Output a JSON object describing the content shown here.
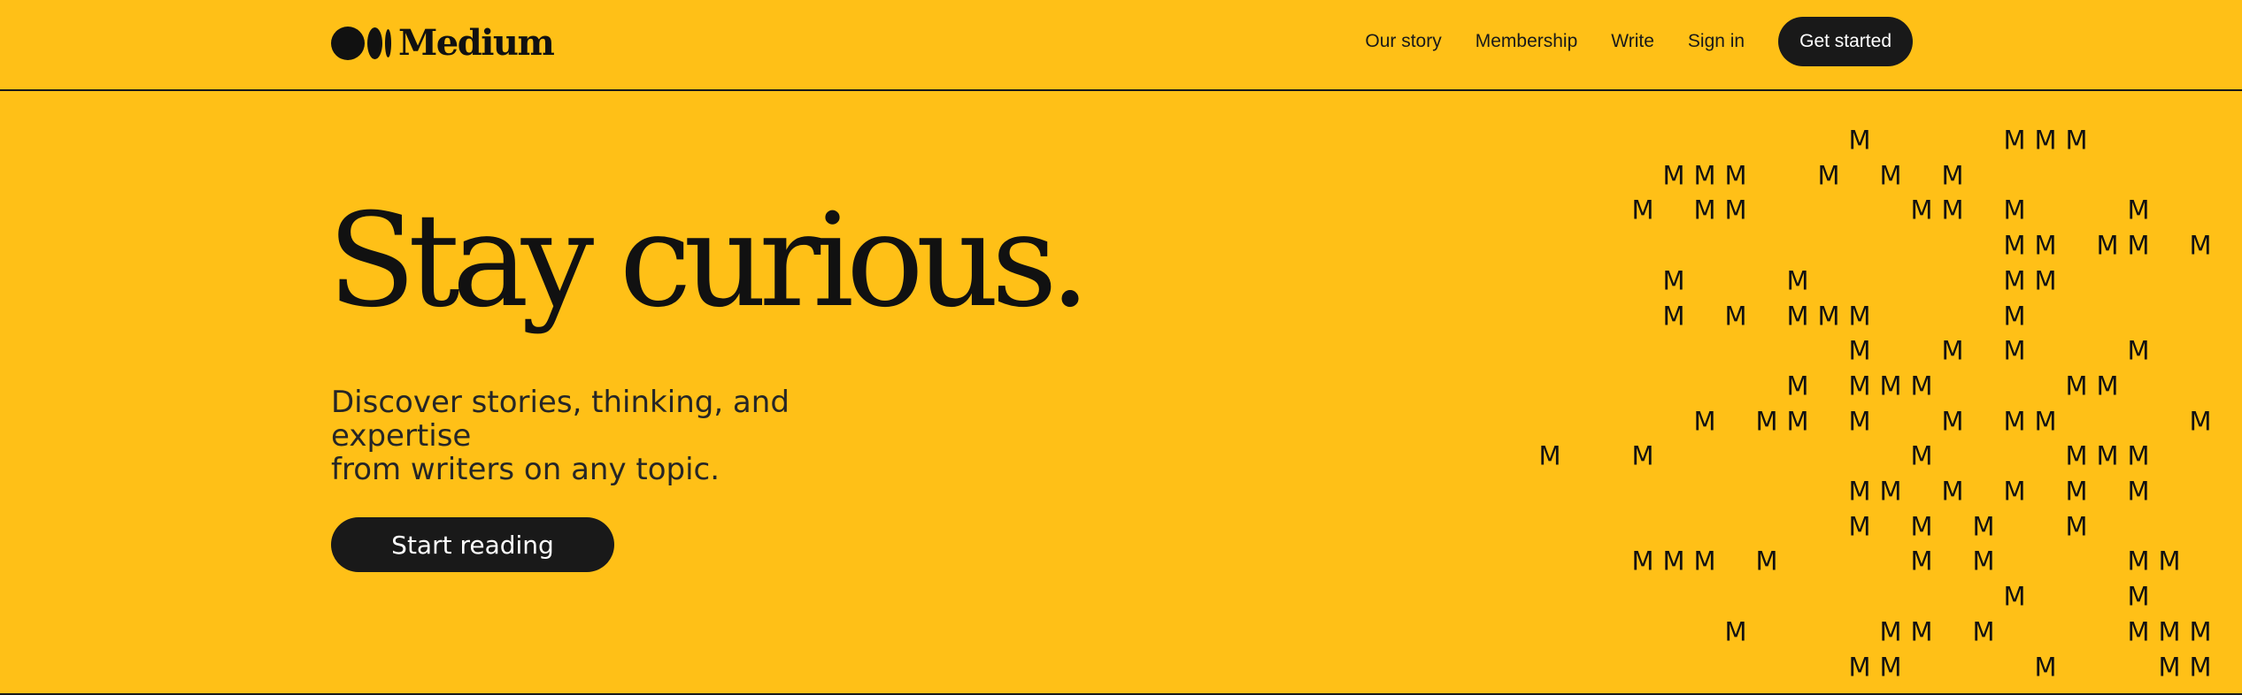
{
  "header": {
    "logo_text": "Medium",
    "nav": [
      {
        "label": "Our story"
      },
      {
        "label": "Membership"
      },
      {
        "label": "Write"
      },
      {
        "label": "Sign in"
      }
    ],
    "cta_label": "Get started"
  },
  "hero": {
    "title": "Stay curious.",
    "subtitle_line1": "Discover stories, thinking, and expertise",
    "subtitle_line2": "from writers on any topic.",
    "button_label": "Start reading"
  },
  "pattern": {
    "glyph": "M",
    "rows": [
      "..........M....MMM....M",
      "....MMM..M.M.M........",
      "...M.MM.....MM.M...M...M",
      "...............MM.MM.MM",
      "....M...M......MM.....M",
      "....M.M.MMM....M......MM",
      "..........M..M.M...M....",
      "........M.MMM....MM....MM",
      ".....M.MM.M..M.MM....MM",
      "M..M........M....MMM..M",
      "..........MM.M.M.M.M....",
      "..........M.M.M..M......",
      "...MMM.M....M.M....MM.M",
      "...............M...M....",
      "......M....MM.M....MMM..",
      "..........MM....M...MMM."
    ],
    "colors": {
      "background": "#FFC017",
      "ink": "#191919"
    }
  }
}
